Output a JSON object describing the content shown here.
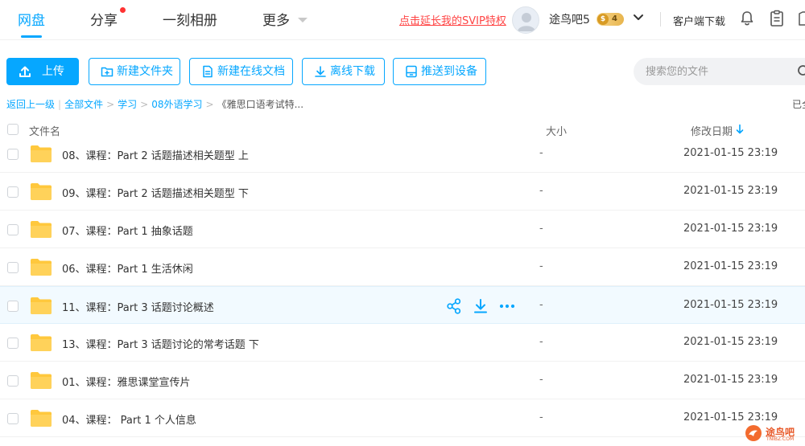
{
  "nav": {
    "tabs": [
      {
        "label": "网盘",
        "active": true
      },
      {
        "label": "分享",
        "active": false,
        "has_dot": true
      },
      {
        "label": "一刻相册",
        "active": false
      },
      {
        "label": "更多",
        "active": false
      }
    ],
    "svip_promo": "点击延长我的SVIP特权",
    "username": "途鸟吧5",
    "vip_badge_symbol": "$",
    "vip_level": "4",
    "client_download": "客户端下载",
    "icons": [
      "bell-icon",
      "clipboard-icon",
      "shirt-icon"
    ]
  },
  "toolbar": {
    "upload": "上传",
    "new_folder": "新建文件夹",
    "new_online_doc": "新建在线文档",
    "offline_download": "离线下载",
    "push_to_device": "推送到设备"
  },
  "search": {
    "placeholder": "搜索您的文件"
  },
  "breadcrumb": {
    "back": "返回上一级",
    "items": [
      "全部文件",
      "学习",
      "08外语学习",
      "《雅思口语考试特..."
    ],
    "loaded_status": "已全"
  },
  "table": {
    "headers": {
      "name": "文件名",
      "size": "大小",
      "modified": "修改日期"
    },
    "sort": "desc",
    "rows": [
      {
        "name": "08、课程：Part 2 话题描述相关题型 上",
        "size": "-",
        "modified": "2021-01-15 23:19"
      },
      {
        "name": "09、课程：Part 2 话题描述相关题型 下",
        "size": "-",
        "modified": "2021-01-15 23:19"
      },
      {
        "name": "07、课程：Part 1 抽象话题",
        "size": "-",
        "modified": "2021-01-15 23:19"
      },
      {
        "name": "06、课程：Part 1 生活休闲",
        "size": "-",
        "modified": "2021-01-15 23:19"
      },
      {
        "name": "11、课程：Part 3 话题讨论概述",
        "size": "-",
        "modified": "2021-01-15 23:19",
        "hovered": true
      },
      {
        "name": "13、课程：Part 3 话题讨论的常考话题 下",
        "size": "-",
        "modified": "2021-01-15 23:19"
      },
      {
        "name": "01、课程：雅思课堂宣传片",
        "size": "-",
        "modified": "2021-01-15 23:19"
      },
      {
        "name": "04、课程： Part 1 个人信息",
        "size": "-",
        "modified": "2021-01-15 23:19"
      }
    ],
    "row_actions": [
      "share-icon",
      "download-icon",
      "more-icon"
    ]
  },
  "watermark": {
    "text": "途鸟吧",
    "sub": "TNIBZ.COM"
  },
  "colors": {
    "accent": "#06a7ff",
    "promo": "#ff4444",
    "folder": "#ffc83d",
    "hover_row": "#f2faff"
  }
}
